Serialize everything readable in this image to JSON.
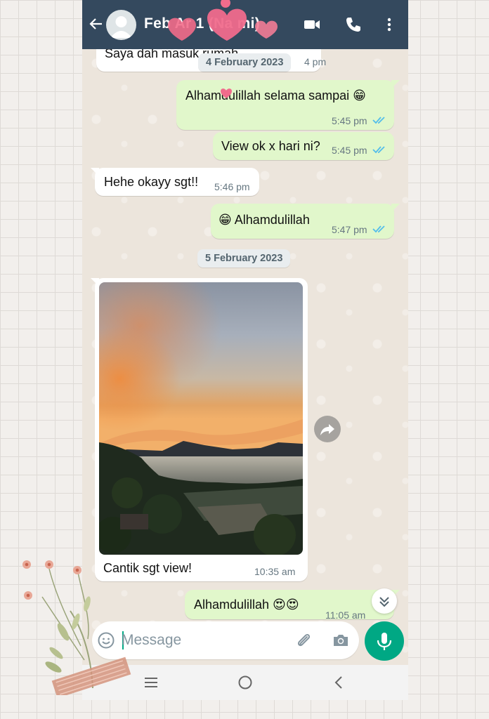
{
  "header": {
    "contact_name": "Feb  Ar  1 (Na  mi)"
  },
  "messages": [
    {
      "id": "m0",
      "direction": "in",
      "text": "Saya dah masuk rumah",
      "time": "4 pm"
    },
    {
      "id": "m1",
      "direction": "out",
      "text": "Alhamdulillah selama sampai 😁",
      "time": "5:45 pm",
      "status": "read"
    },
    {
      "id": "m2",
      "direction": "out",
      "text": "View ok x hari ni?",
      "time": "5:45 pm",
      "status": "read"
    },
    {
      "id": "m3",
      "direction": "in",
      "text": "Hehe okayy sgt!!",
      "time": "5:46 pm"
    },
    {
      "id": "m4",
      "direction": "out",
      "text": "😁 Alhamdulillah",
      "time": "5:47 pm",
      "status": "read"
    },
    {
      "id": "m5",
      "direction": "in",
      "type": "image",
      "caption": "Cantik sgt view!",
      "time": "10:35 am"
    },
    {
      "id": "m6",
      "direction": "out",
      "text": "Alhamdulillah 😍😍",
      "time": "11:05 am",
      "status": "read"
    }
  ],
  "dates": {
    "feb4": "4 February 2023",
    "feb5": "5 February 2023"
  },
  "composer": {
    "placeholder": "Message"
  },
  "colors": {
    "header_bg": "#34495e",
    "outgoing_bubble": "#e1f7cb",
    "incoming_bubble": "#ffffff",
    "accent": "#00a884",
    "read_ticks": "#53bdeb"
  },
  "icons": {
    "back": "arrow-left-icon",
    "video": "video-camera-icon",
    "call": "phone-icon",
    "menu": "more-vertical-icon",
    "emoji": "emoji-icon",
    "attach": "paperclip-icon",
    "camera": "camera-icon",
    "mic": "microphone-icon",
    "share": "share-icon",
    "scroll": "double-chevron-down-icon",
    "nav_recent": "recent-apps-icon",
    "nav_home": "home-circle-icon",
    "nav_back": "nav-back-icon"
  }
}
